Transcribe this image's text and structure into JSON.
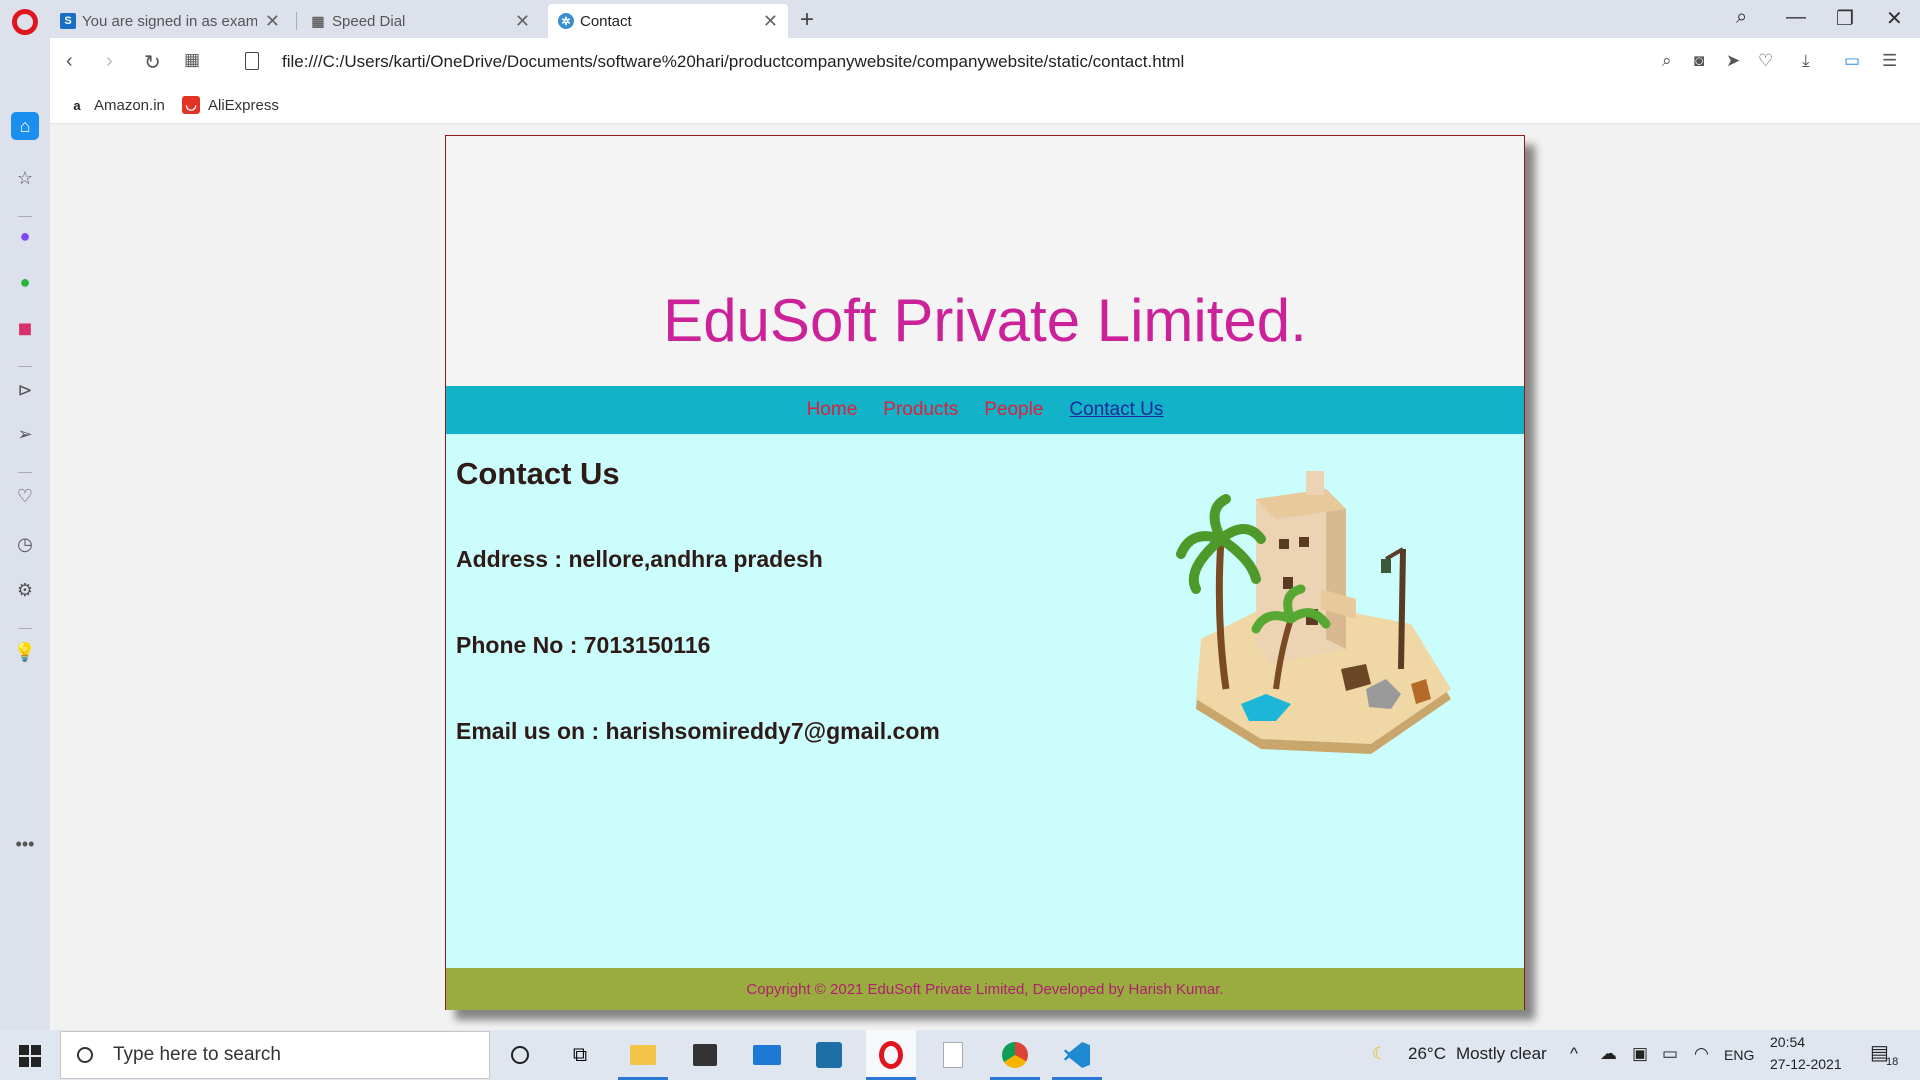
{
  "browser": {
    "tabs": [
      {
        "title": "You are signed in as exam",
        "icon": "s-favicon",
        "active": false
      },
      {
        "title": "Speed Dial",
        "icon": "grid-favicon",
        "active": false
      },
      {
        "title": "Contact",
        "icon": "gear-favicon",
        "active": true
      }
    ],
    "url": "file:///C:/Users/karti/OneDrive/Documents/software%20hari/productcompanywebsite/companywebsite/static/contact.html",
    "bookmarks": [
      {
        "label": "Amazon.in",
        "icon": "amazon-icon"
      },
      {
        "label": "AliExpress",
        "icon": "aliexpress-icon"
      }
    ]
  },
  "site": {
    "title": "EduSoft Private Limited.",
    "nav": [
      "Home",
      "Products",
      "People",
      "Contact Us"
    ],
    "current_nav": "Contact Us",
    "heading": "Contact Us",
    "address": "Address : nellore,andhra pradesh",
    "phone": "Phone No : 7013150116",
    "email": "Email us on : harishsomireddy7@gmail.com",
    "footer": "Copyright © 2021 EduSoft Private Limited, Developed by Harish Kumar."
  },
  "taskbar": {
    "search_placeholder": "Type here to search",
    "weather_temp": "26°C",
    "weather_text": "Mostly clear",
    "language": "ENG",
    "time": "20:54",
    "date": "27-12-2021",
    "notification_count": "18"
  },
  "colors": {
    "title": "#cc2299",
    "nav_bg": "#12b2c8",
    "nav_link": "#e0203a",
    "main_bg": "#cbfdfd",
    "footer_bg": "#9aac40",
    "footer_text": "#b0206e"
  }
}
